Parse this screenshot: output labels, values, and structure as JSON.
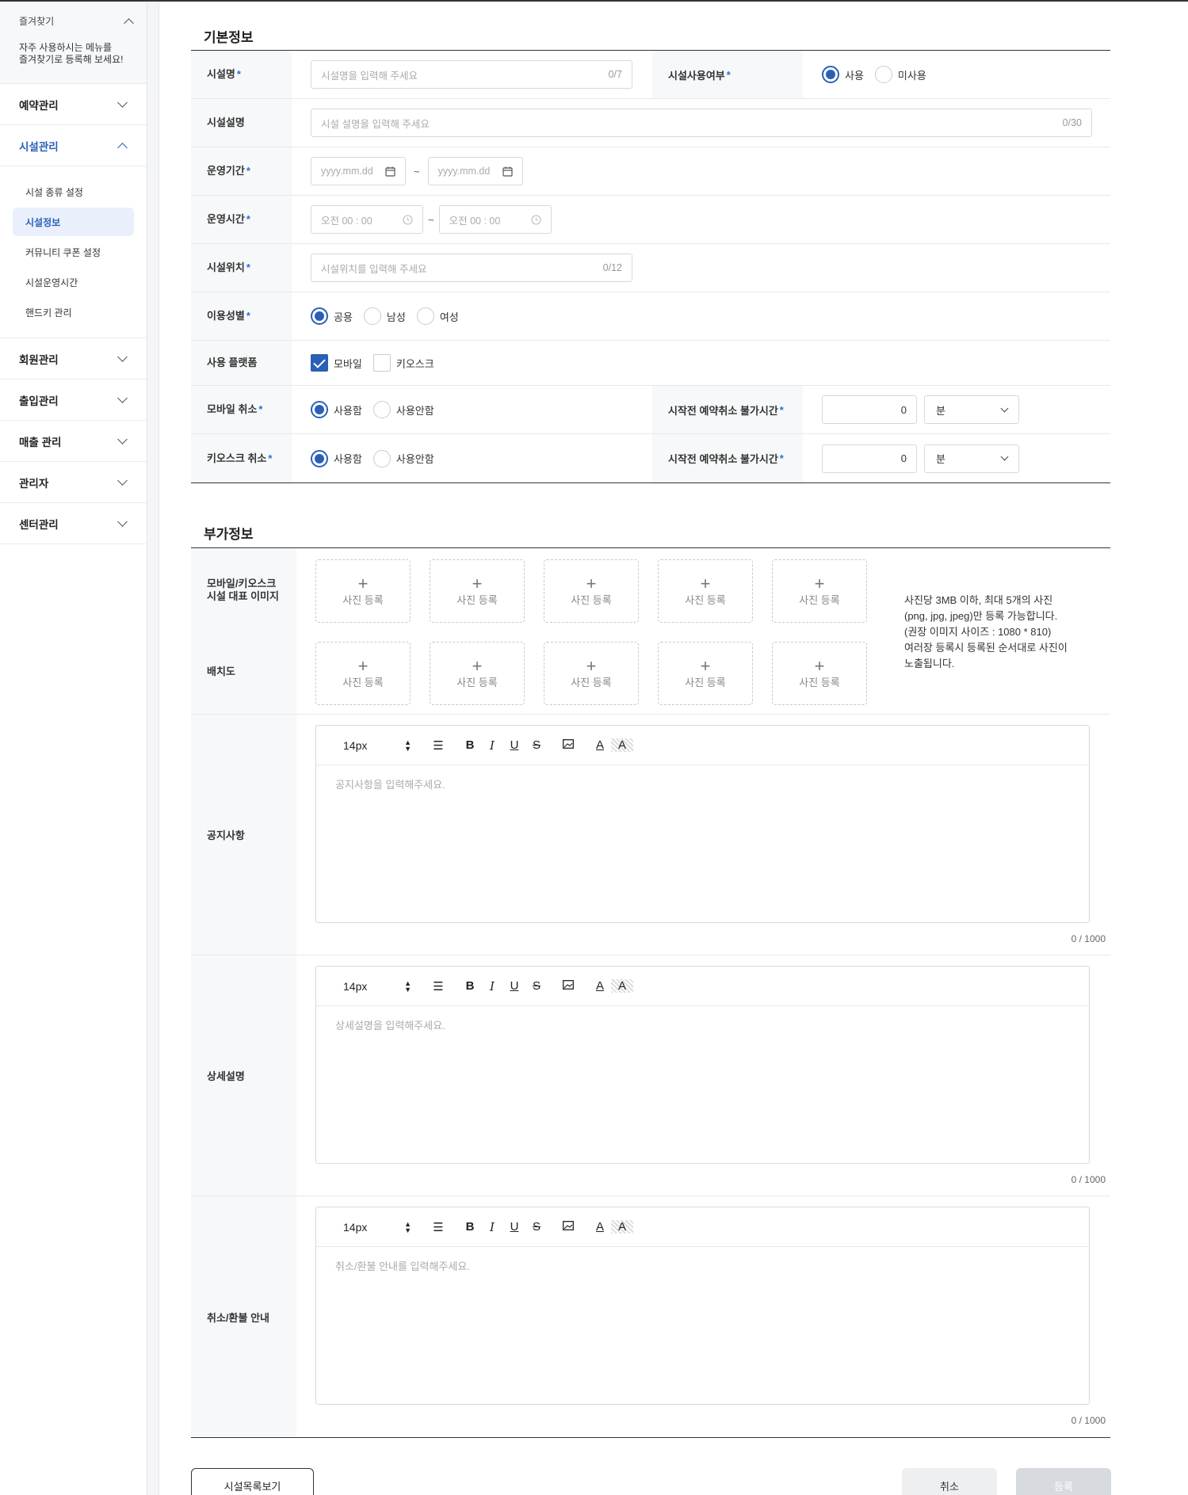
{
  "sidebar": {
    "favorites": {
      "title": "즐겨찾기",
      "desc_line1": "자주 사용하시는 메뉴를",
      "desc_line2": "즐겨찾기로 등록해 보세요!"
    },
    "menu": [
      {
        "label": "예약관리"
      },
      {
        "label": "시설관리"
      },
      {
        "label": "회원관리"
      },
      {
        "label": "출입관리"
      },
      {
        "label": "매출 관리"
      },
      {
        "label": "관리자"
      },
      {
        "label": "센터관리"
      }
    ],
    "submenu": [
      {
        "label": "시설 종류 설정"
      },
      {
        "label": "시설정보"
      },
      {
        "label": "커뮤니티 쿠폰 설정"
      },
      {
        "label": "시설운영시간"
      },
      {
        "label": "핸드키 관리"
      }
    ]
  },
  "basic": {
    "title": "기본정보",
    "name_label": "시설명",
    "name_placeholder": "시설명을 입력해 주세요",
    "name_count": "0/7",
    "use_label": "시설사용여부",
    "use_options": [
      "사용",
      "미사용"
    ],
    "desc_label": "시설설명",
    "desc_placeholder": "시설 설명을 입력해 주세요",
    "desc_count": "0/30",
    "period_label": "운영기간",
    "date_placeholder": "yyyy.mm.dd",
    "tilde": "~",
    "hours_label": "운영시간",
    "time_placeholder": "오전 00 : 00",
    "location_label": "시설위치",
    "location_placeholder": "시설위치를 입력해 주세요",
    "location_count": "0/12",
    "gender_label": "이용성별",
    "gender_options": [
      "공용",
      "남성",
      "여성"
    ],
    "platform_label": "사용 플랫폼",
    "platform_options": [
      "모바일",
      "키오스크"
    ],
    "mobile_cancel_label": "모바일 취소",
    "kiosk_cancel_label": "키오스크 취소",
    "cancel_options": [
      "사용함",
      "사용안함"
    ],
    "cancel_limit_label": "시작전 예약취소 불가시간",
    "cancel_limit_value": "0",
    "unit": "분",
    "required_mark": "*"
  },
  "extra": {
    "title": "부가정보",
    "image_label_line1": "모바일/키오스크",
    "image_label_line2": "시설 대표 이미지",
    "layout_label": "배치도",
    "upload_plus": "+",
    "upload_text": "사진 등록",
    "upload_note_lines": [
      "사진당 3MB 이하, 최대 5개의 사진",
      "(png, jpg, jpeg)만 등록 가능합니다.",
      "(권장 이미지 사이즈 : 1080 * 810)",
      "여러장 등록시 등록된 순서대로 사진이",
      "노출됩니다."
    ],
    "editors": [
      {
        "label": "공지사항",
        "placeholder": "공지사항을 입력해주세요.",
        "count": "0 / 1000"
      },
      {
        "label": "상세설명",
        "placeholder": "상세설명을 입력해주세요.",
        "count": "0 / 1000"
      },
      {
        "label": "취소/환불 안내",
        "placeholder": "취소/환불 안내를 입력해주세요.",
        "count": "0 / 1000"
      }
    ],
    "toolbar": {
      "font_size": "14px",
      "bold": "B",
      "italic": "I",
      "underline": "U",
      "strike": "S",
      "text_color": "A",
      "bg_color": "A"
    }
  },
  "buttons": {
    "list": "시설목록보기",
    "cancel": "취소",
    "submit": "등록"
  },
  "colors": {
    "accent": "#2b5fb7",
    "required": "#2b6fd6"
  }
}
